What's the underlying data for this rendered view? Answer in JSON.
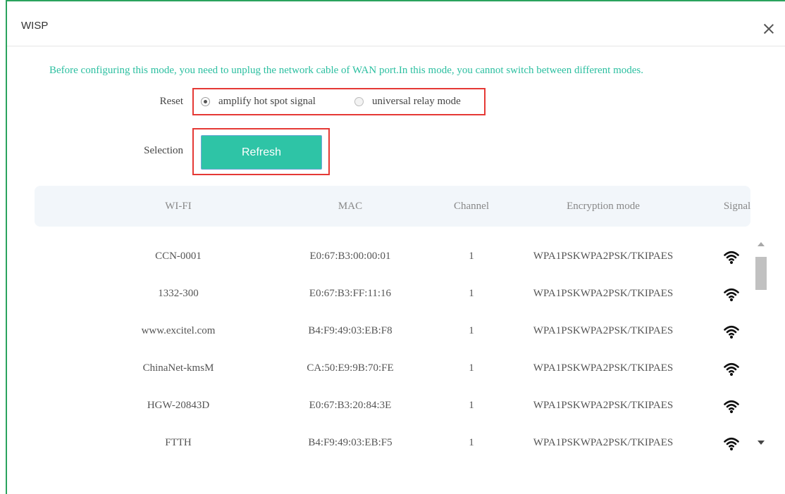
{
  "dialog": {
    "title": "WISP",
    "close_label": "×"
  },
  "notice": "Before configuring this mode, you need to unplug the network cable of WAN port.In this mode, you cannot switch between different modes.",
  "form": {
    "reset_label": "Reset",
    "selection_label": "Selection",
    "modes": [
      {
        "label": "amplify hot spot signal",
        "checked": true
      },
      {
        "label": "universal relay mode",
        "checked": false
      }
    ],
    "refresh_label": "Refresh"
  },
  "table": {
    "headers": [
      "WI-FI",
      "MAC",
      "Channel",
      "Encryption mode",
      "Signal"
    ],
    "rows": [
      {
        "ssid": "CCN-0001",
        "mac": "E0:67:B3:00:00:01",
        "channel": "1",
        "encryption": "WPA1PSKWPA2PSK/TKIPAES",
        "signal_icon": "wifi-full-icon"
      },
      {
        "ssid": "1332-300",
        "mac": "E0:67:B3:FF:11:16",
        "channel": "1",
        "encryption": "WPA1PSKWPA2PSK/TKIPAES",
        "signal_icon": "wifi-full-icon"
      },
      {
        "ssid": "www.excitel.com",
        "mac": "B4:F9:49:03:EB:F8",
        "channel": "1",
        "encryption": "WPA1PSKWPA2PSK/TKIPAES",
        "signal_icon": "wifi-full-icon"
      },
      {
        "ssid": "ChinaNet-kmsM",
        "mac": "CA:50:E9:9B:70:FE",
        "channel": "1",
        "encryption": "WPA1PSKWPA2PSK/TKIPAES",
        "signal_icon": "wifi-full-icon"
      },
      {
        "ssid": "HGW-20843D",
        "mac": "E0:67:B3:20:84:3E",
        "channel": "1",
        "encryption": "WPA1PSKWPA2PSK/TKIPAES",
        "signal_icon": "wifi-full-icon"
      },
      {
        "ssid": "FTTH",
        "mac": "B4:F9:49:03:EB:F5",
        "channel": "1",
        "encryption": "WPA1PSKWPA2PSK/TKIPAES",
        "signal_icon": "wifi-full-icon"
      }
    ]
  },
  "colors": {
    "accent": "#2ec4a6",
    "notice_text": "#2bbfa0",
    "window_border": "#2aa35d",
    "highlight_box": "#e53935"
  }
}
